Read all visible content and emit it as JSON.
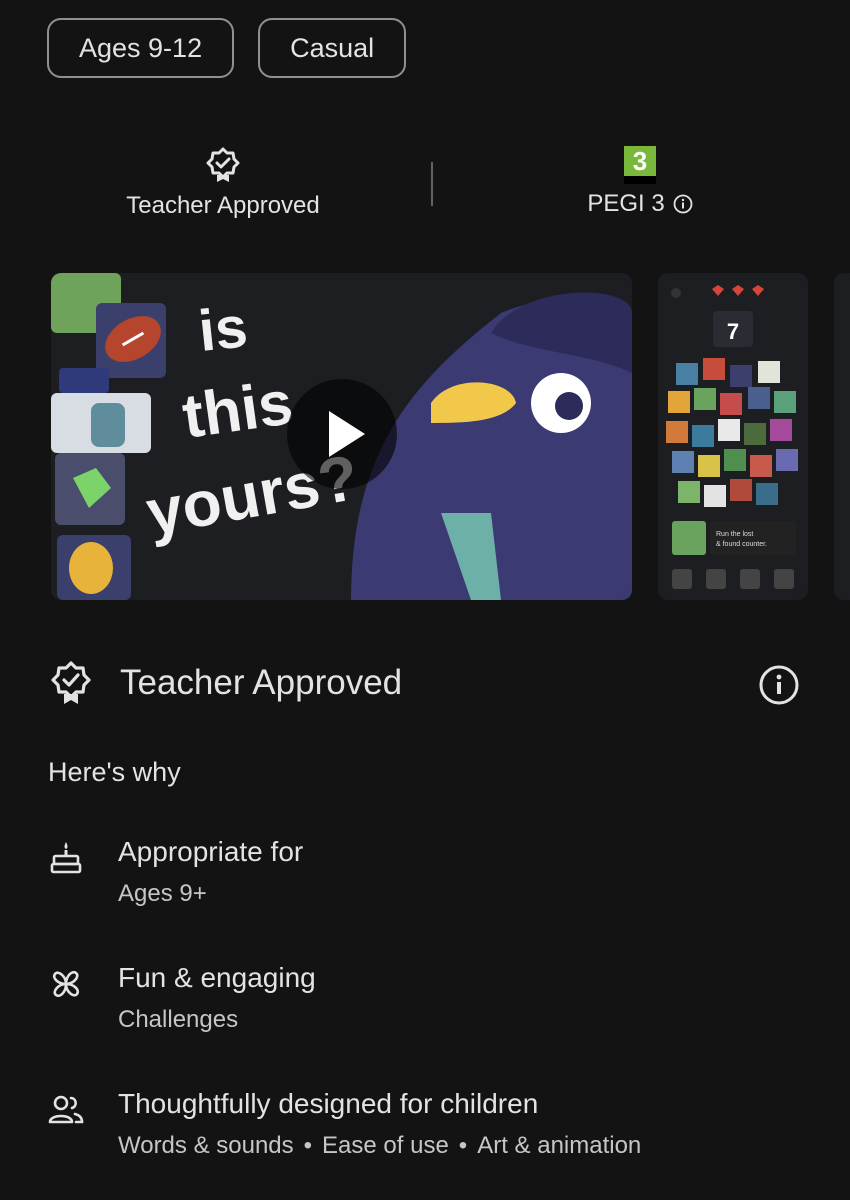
{
  "chips": [
    "Ages 9-12",
    "Casual"
  ],
  "badges": {
    "teacher": "Teacher Approved",
    "pegi_number": "3",
    "pegi": "PEGI 3"
  },
  "media": {
    "video_text": [
      "is",
      "this",
      "yours?"
    ],
    "shot_counter": "7",
    "shot_caption": [
      "Run the lost",
      "& found counter."
    ]
  },
  "section": {
    "title": "Teacher Approved",
    "why": "Here's why"
  },
  "reasons": [
    {
      "title": "Appropriate for",
      "detail": "Ages 9+",
      "icon": "cake-icon"
    },
    {
      "title": "Fun & engaging",
      "detail": "Challenges",
      "icon": "pinwheel-icon"
    },
    {
      "title": "Thoughtfully designed for children",
      "details": [
        "Words & sounds",
        "Ease of use",
        "Art & animation"
      ],
      "icon": "people-icon"
    }
  ]
}
